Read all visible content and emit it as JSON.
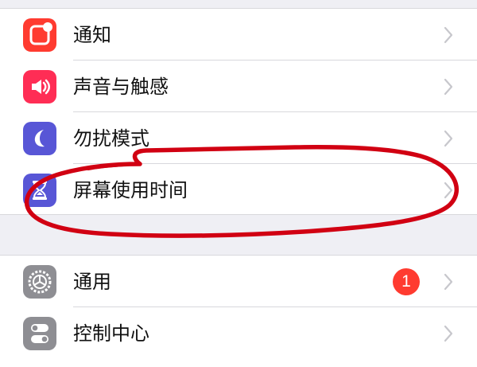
{
  "settings": {
    "group_1": [
      {
        "label": "通知",
        "icon": "notifications-icon",
        "icon_color": "#ff3b30"
      },
      {
        "label": "声音与触感",
        "icon": "sound-icon",
        "icon_color": "#ff2d55"
      },
      {
        "label": "勿扰模式",
        "icon": "moon-icon",
        "icon_color": "#5856d6"
      },
      {
        "label": "屏幕使用时间",
        "icon": "hourglass-icon",
        "icon_color": "#5856d6"
      }
    ],
    "group_2": [
      {
        "label": "通用",
        "icon": "gear-icon",
        "icon_color": "#8e8e93",
        "badge": "1",
        "badge_color": "#ff3b30"
      },
      {
        "label": "控制中心",
        "icon": "toggles-icon",
        "icon_color": "#8e8e93"
      }
    ]
  },
  "annotation": {
    "shape": "red-hand-drawn-ellipse",
    "color": "#d10012",
    "highlighted_item": "屏幕使用时间"
  }
}
